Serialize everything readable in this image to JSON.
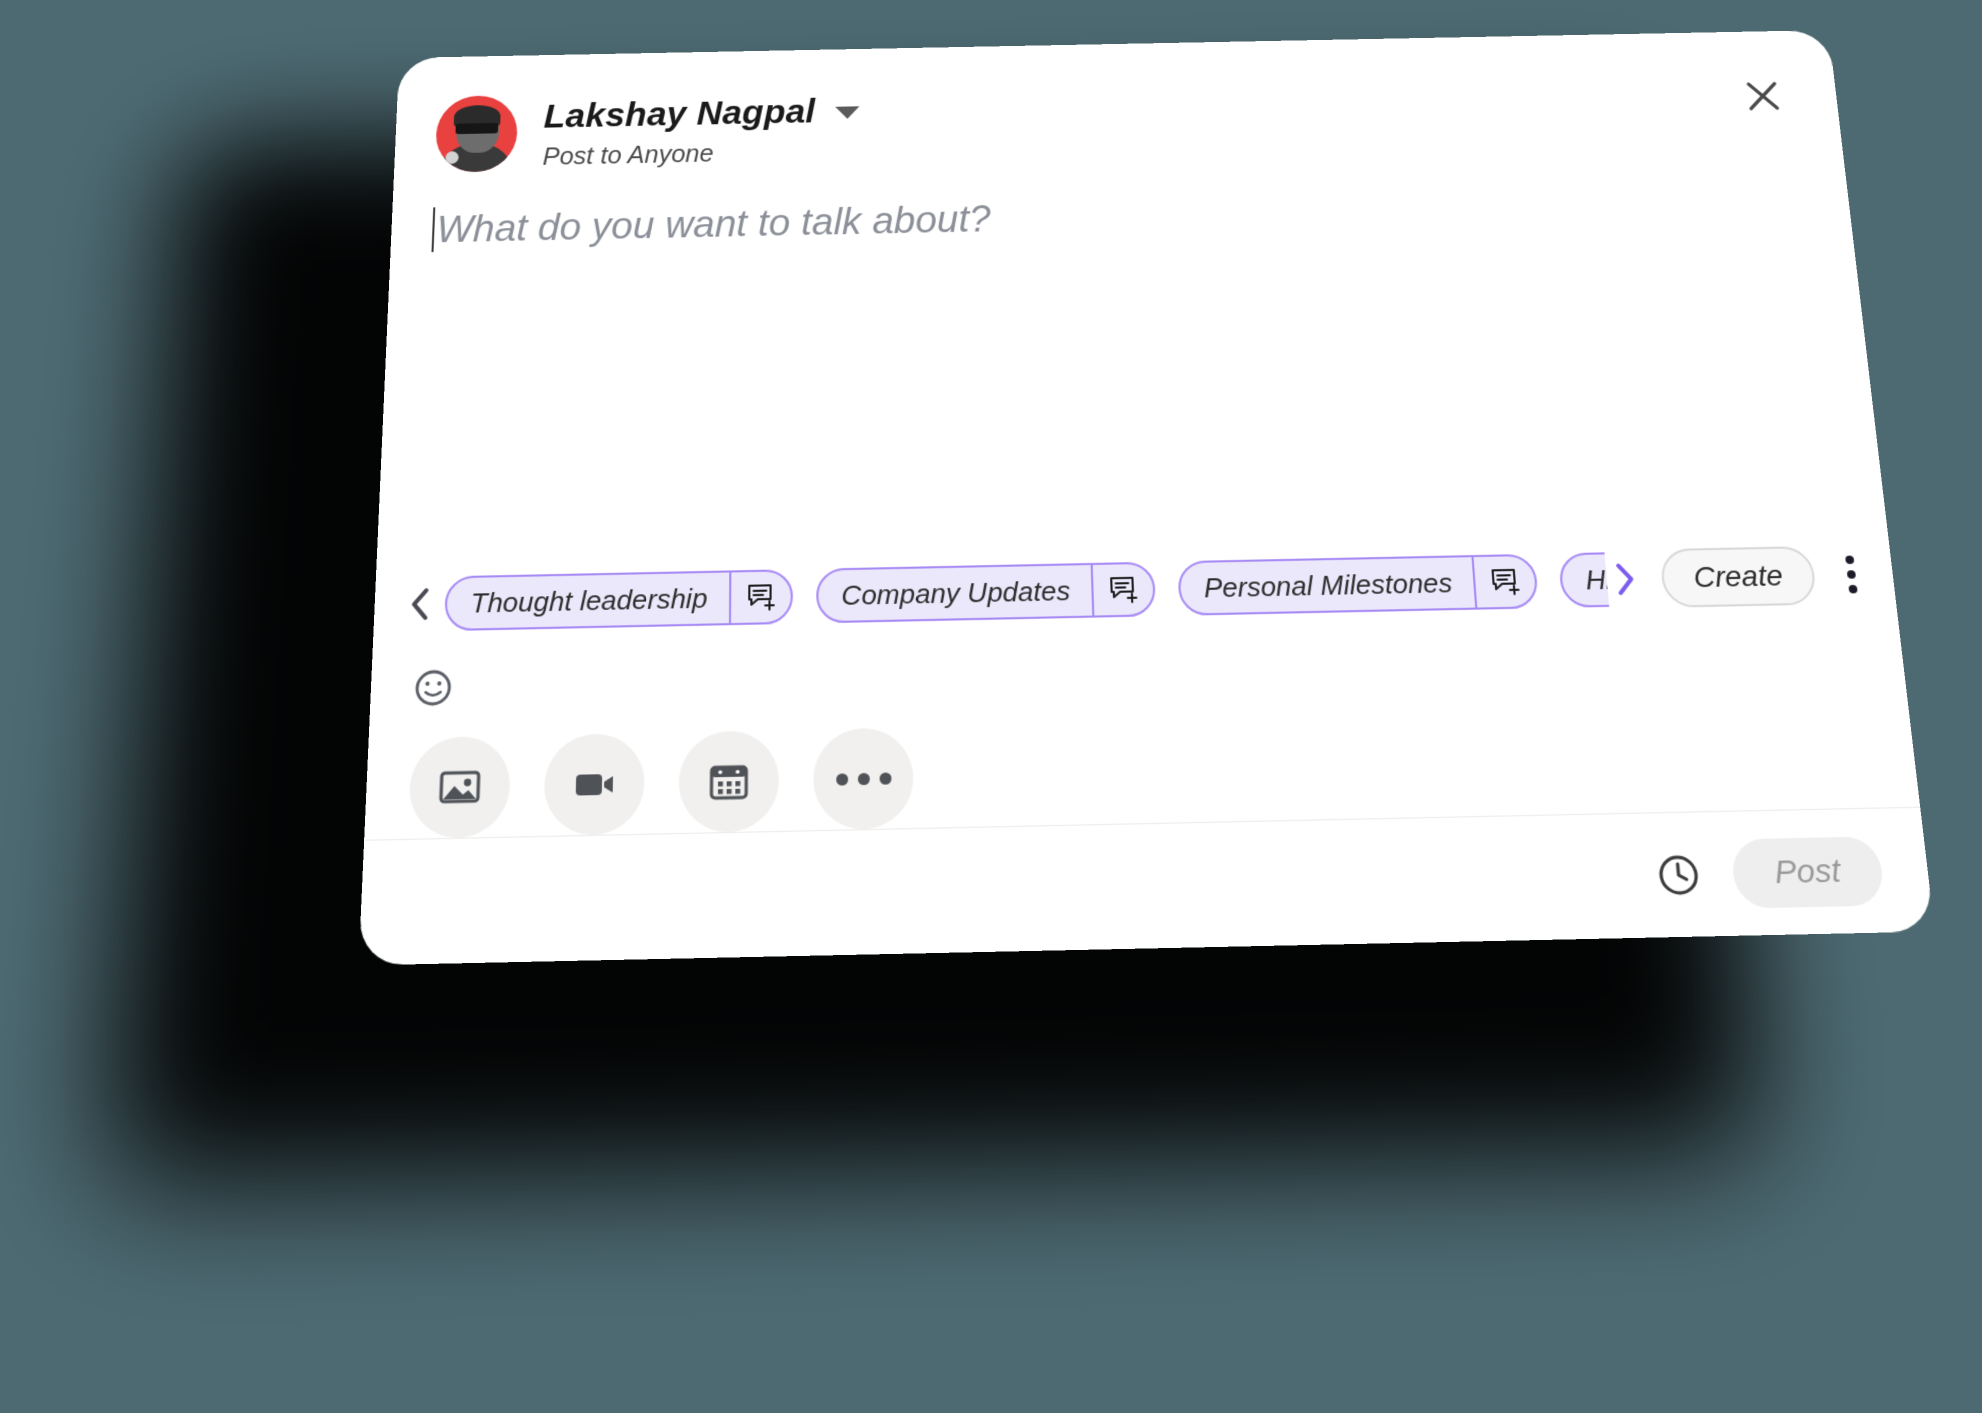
{
  "background": {
    "color": "#4d6a72"
  },
  "card": {
    "accent_purple": "#a78bf5",
    "chip_fill": "#ece8fb",
    "avatar_bg": "#e8413f"
  },
  "header": {
    "avatar_name": "avatar",
    "user_name": "Lakshay Nagpal",
    "audience": "Post to Anyone",
    "dropdown_icon": "chevron-down-icon",
    "close_icon": "close-icon"
  },
  "editor": {
    "placeholder": "What do you want to talk about?",
    "value": ""
  },
  "chips": {
    "prev_icon": "chevron-left-icon",
    "next_icon": "chevron-right-icon",
    "items": [
      {
        "label": "Thought leadership",
        "action_icon": "comment-add-icon"
      },
      {
        "label": "Company Updates",
        "action_icon": "comment-add-icon"
      },
      {
        "label": "Personal Milestones",
        "action_icon": "comment-add-icon"
      },
      {
        "label": "Hi",
        "action_icon": "comment-add-icon"
      }
    ],
    "create_label": "Create",
    "more_icon": "kebab-menu-icon"
  },
  "emoji": {
    "icon": "smiley-icon"
  },
  "media": {
    "buttons": [
      {
        "name": "add-photo-button",
        "icon": "image-icon"
      },
      {
        "name": "add-video-button",
        "icon": "video-icon"
      },
      {
        "name": "add-event-button",
        "icon": "calendar-icon"
      },
      {
        "name": "more-options-button",
        "icon": "ellipsis-icon"
      }
    ]
  },
  "footer": {
    "schedule_icon": "clock-icon",
    "post_label": "Post"
  }
}
